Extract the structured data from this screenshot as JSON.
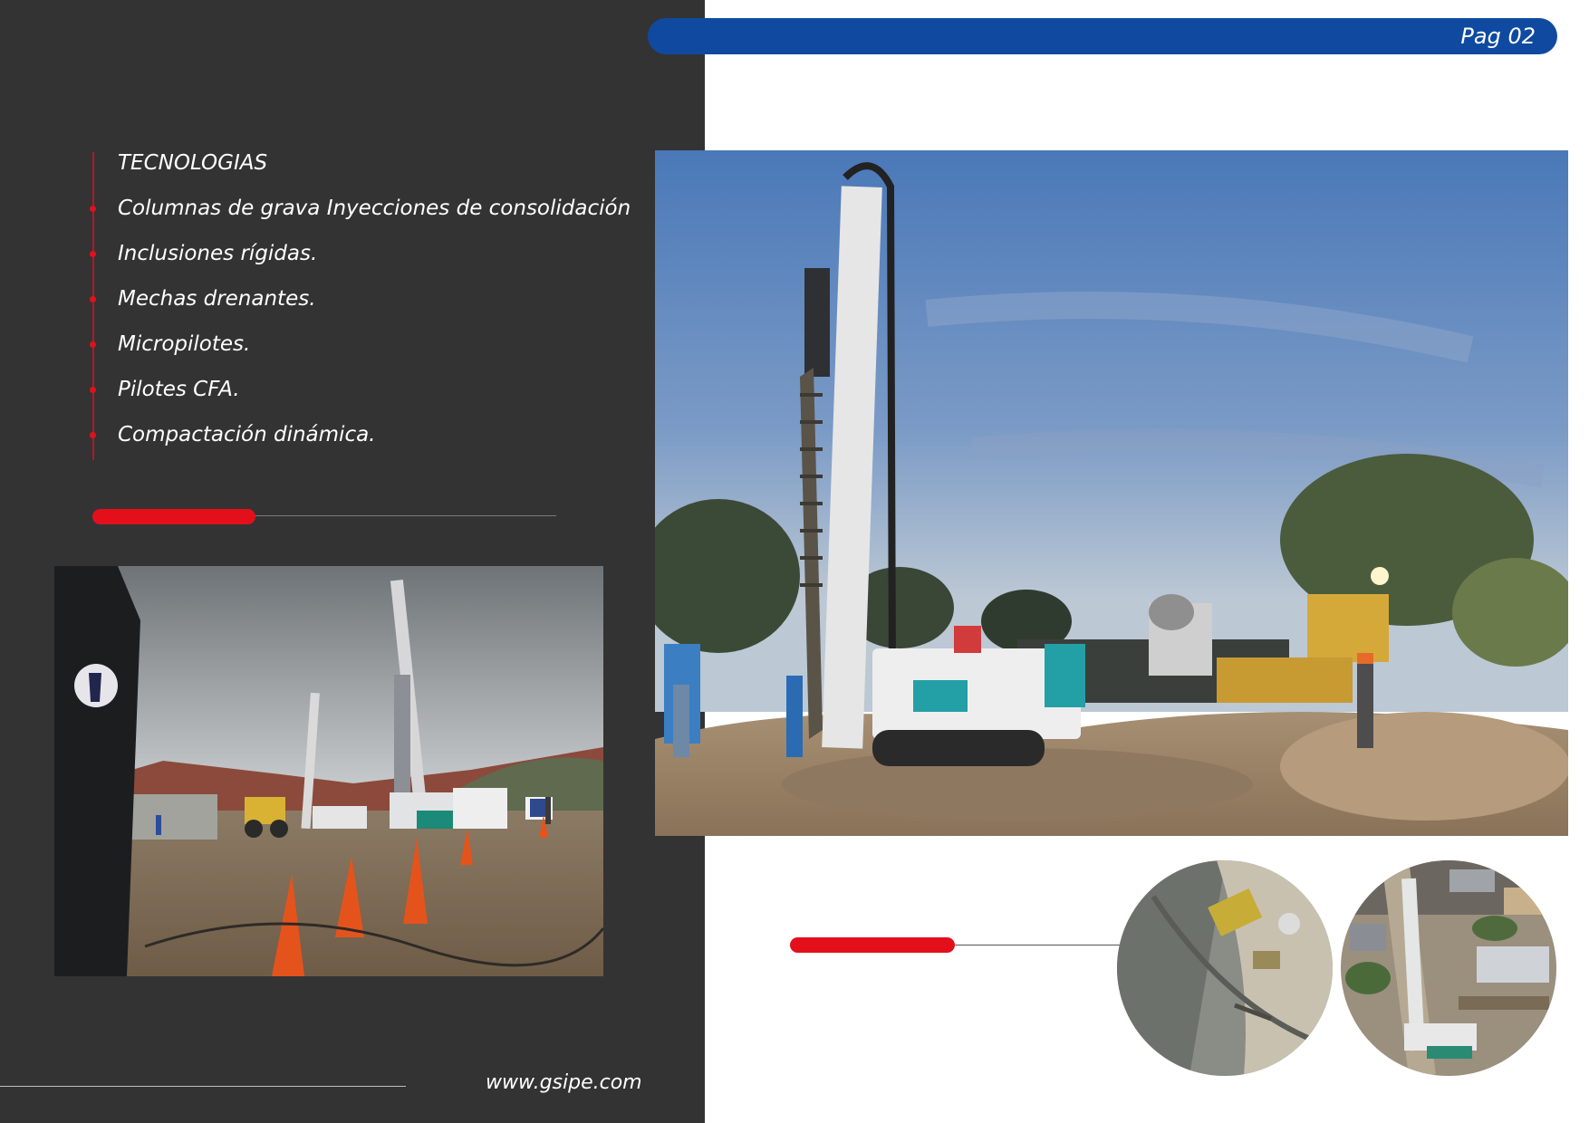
{
  "header": {
    "page_label": "Pag 02"
  },
  "technologies": {
    "title": "TECNOLOGIAS",
    "items": [
      "Columnas de grava Inyecciones de consolidación",
      "Inclusiones rígidas.",
      "Mechas drenantes.",
      "Micropilotes.",
      "Pilotes CFA.",
      "Compactación dinámica."
    ]
  },
  "footer": {
    "website": "www.gsipe.com"
  },
  "colors": {
    "panel": "#333334",
    "header": "#0f4aa0",
    "accent": "#e3101c"
  }
}
